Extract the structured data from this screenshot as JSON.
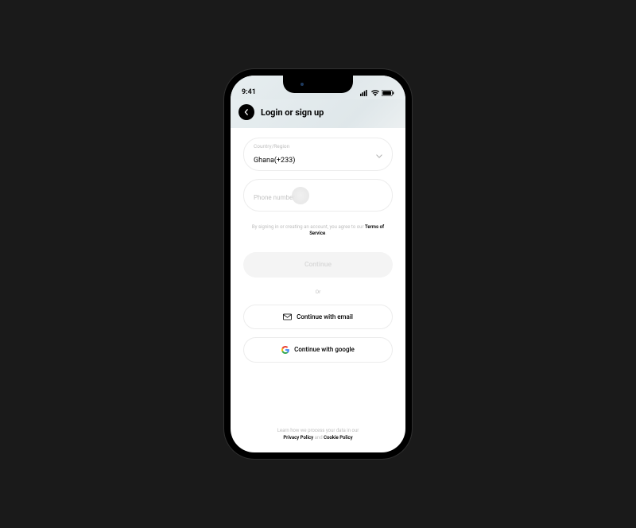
{
  "status": {
    "time": "9:41"
  },
  "header": {
    "title": "Login or sign up"
  },
  "country": {
    "label": "Country/Region",
    "value": "Ghana(+233)"
  },
  "phone": {
    "placeholder": "Phone number"
  },
  "legal": {
    "pre": "By signing in or creating an account, you agree to our ",
    "tos": "Terms of Service",
    "suffix": "."
  },
  "continue": {
    "label": "Continue"
  },
  "or": "Or",
  "email_btn": "Continue with email",
  "google_btn": "Continue with google",
  "footer": {
    "pre": "Learn how we process your data in our",
    "privacy": "Privacy Policy",
    "and": " and ",
    "cookie": "Cookie Policy"
  }
}
